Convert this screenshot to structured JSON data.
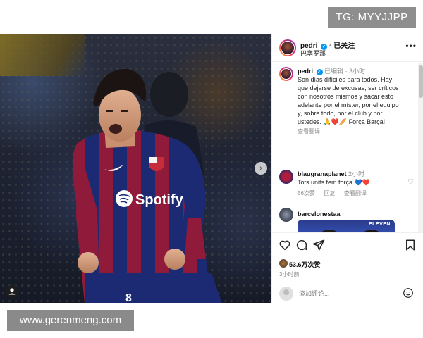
{
  "watermarks": {
    "top": "TG: MYYJJPP",
    "bottom": "www.gerenmeng.com"
  },
  "header": {
    "username": "pedri",
    "follow_state": "已关注",
    "location": "巴塞罗那"
  },
  "caption": {
    "username": "pedri",
    "edited": "已编辑",
    "time": "3小时",
    "text_lines": [
      "Son días difíciles para todos. Hay",
      "que dejarse de excusas, ser críticos",
      "con nosotros mismos y sacar esto",
      "adelante por el míster, por el equipo",
      "y, sobre todo, por el club y por",
      "ustedes. 🙏❤️🥖 Força Barça!"
    ],
    "translate": "查看翻译"
  },
  "comments": [
    {
      "username": "blaugranaplanet",
      "time": "2小时",
      "text": "Tots units fem força 💙❤️",
      "likes": "56次赞",
      "reply": "回复",
      "translate": "查看翻译"
    },
    {
      "username": "barcelonestaa",
      "image_caption": "ELEVEN"
    }
  ],
  "actions": {
    "likes": "53.6万次赞",
    "time": "3小时前"
  },
  "add_comment": {
    "placeholder": "添加评论..."
  },
  "photo": {
    "jersey_sponsor": "Spotify"
  },
  "colors": {
    "accent_blue": "#0095f6",
    "barca_blue": "#1f2f7a",
    "barca_red": "#a51d3c",
    "heart_red": "#ed4956"
  }
}
